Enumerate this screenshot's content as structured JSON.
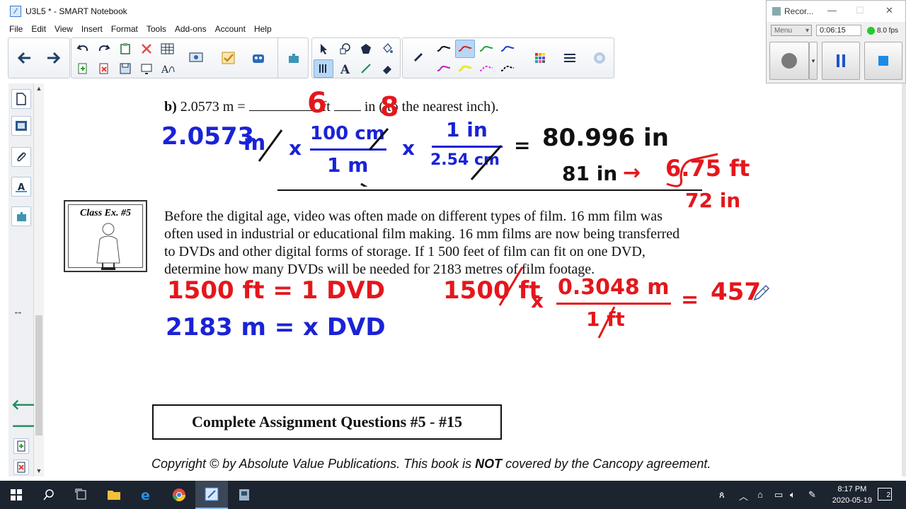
{
  "window": {
    "title": "U3L5 * - SMART Notebook"
  },
  "menu": [
    "File",
    "Edit",
    "View",
    "Insert",
    "Format",
    "Tools",
    "Add-ons",
    "Account",
    "Help"
  ],
  "recorder": {
    "title": "Recor...",
    "menu_label": "Menu",
    "elapsed": "0:06:15",
    "fps": "8.0 fps"
  },
  "page": {
    "question_b": {
      "label": "b)",
      "value": "2.0573 m =",
      "unit_ft": "ft",
      "suffix": "in ( to the nearest inch)."
    },
    "handwriting": {
      "ans_ft": "6",
      "ans_in": "8",
      "row1_start": "2.0573",
      "row1_unit": "m",
      "times1": "x",
      "frac1_num": "100 cm",
      "frac1_den": "1 m",
      "times2": "x",
      "frac2_num": "1 in",
      "frac2_den": "2.54 cm",
      "equals1": "=",
      "result1": "80.996 in",
      "rounded": "81 in",
      "arrow": "→",
      "feet_result": "6.75 ft",
      "inches_note": "72 in",
      "line1": "1500 ft = 1 DVD",
      "line2": "2183 m = x DVD",
      "conv_start": "1500 ft",
      "times3": "x",
      "frac3_num": "0.3048 m",
      "frac3_den": "1 ft",
      "equals2": "=",
      "partial": "457"
    },
    "class_ex_label": "Class Ex. #5",
    "paragraph_lines": [
      "Before the digital age, video was often made on different types of film.  16 mm film was",
      "often used in industrial or educational film making.  16 mm  films are now being transferred",
      "to DVDs and other digital forms of storage.  If 1 500 feet  of film can fit on one DVD,",
      "determine how many DVDs will be needed for  2183 metres  of film footage."
    ],
    "assignment": "Complete Assignment Questions #5 - #15",
    "copyright_pre": "Copyright © by Absolute Value Publications.  This book is ",
    "copyright_not": "NOT",
    "copyright_post": " covered by the Cancopy agreement."
  },
  "taskbar": {
    "time": "8:17 PM",
    "date": "2020-05-19",
    "notification_count": "2"
  },
  "colors": {
    "ink_blue": "#1a23d6",
    "ink_red": "#e4171c",
    "taskbar": "#1c2430"
  }
}
